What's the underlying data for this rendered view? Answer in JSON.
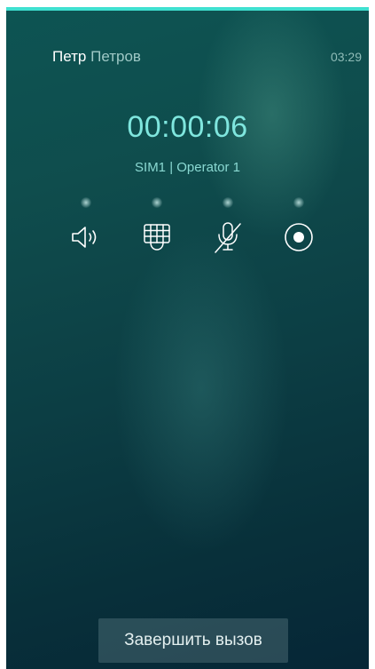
{
  "caller": {
    "first_name": "Петр",
    "last_name": "Петров"
  },
  "status_bar": {
    "time": "03:29"
  },
  "call": {
    "duration": "00:00:06",
    "sim_info": "SIM1 | Operator 1"
  },
  "controls": [
    {
      "icon": "speaker-icon",
      "active": false
    },
    {
      "icon": "keypad-icon",
      "active": false
    },
    {
      "icon": "mute-microphone-icon",
      "active": false
    },
    {
      "icon": "record-icon",
      "active": false
    }
  ],
  "actions": {
    "end_call_label": "Завершить вызов"
  },
  "colors": {
    "accent": "#3fe0d0",
    "timer": "#7fe6de",
    "background_top": "#0d5453",
    "background_bottom": "#062636"
  }
}
